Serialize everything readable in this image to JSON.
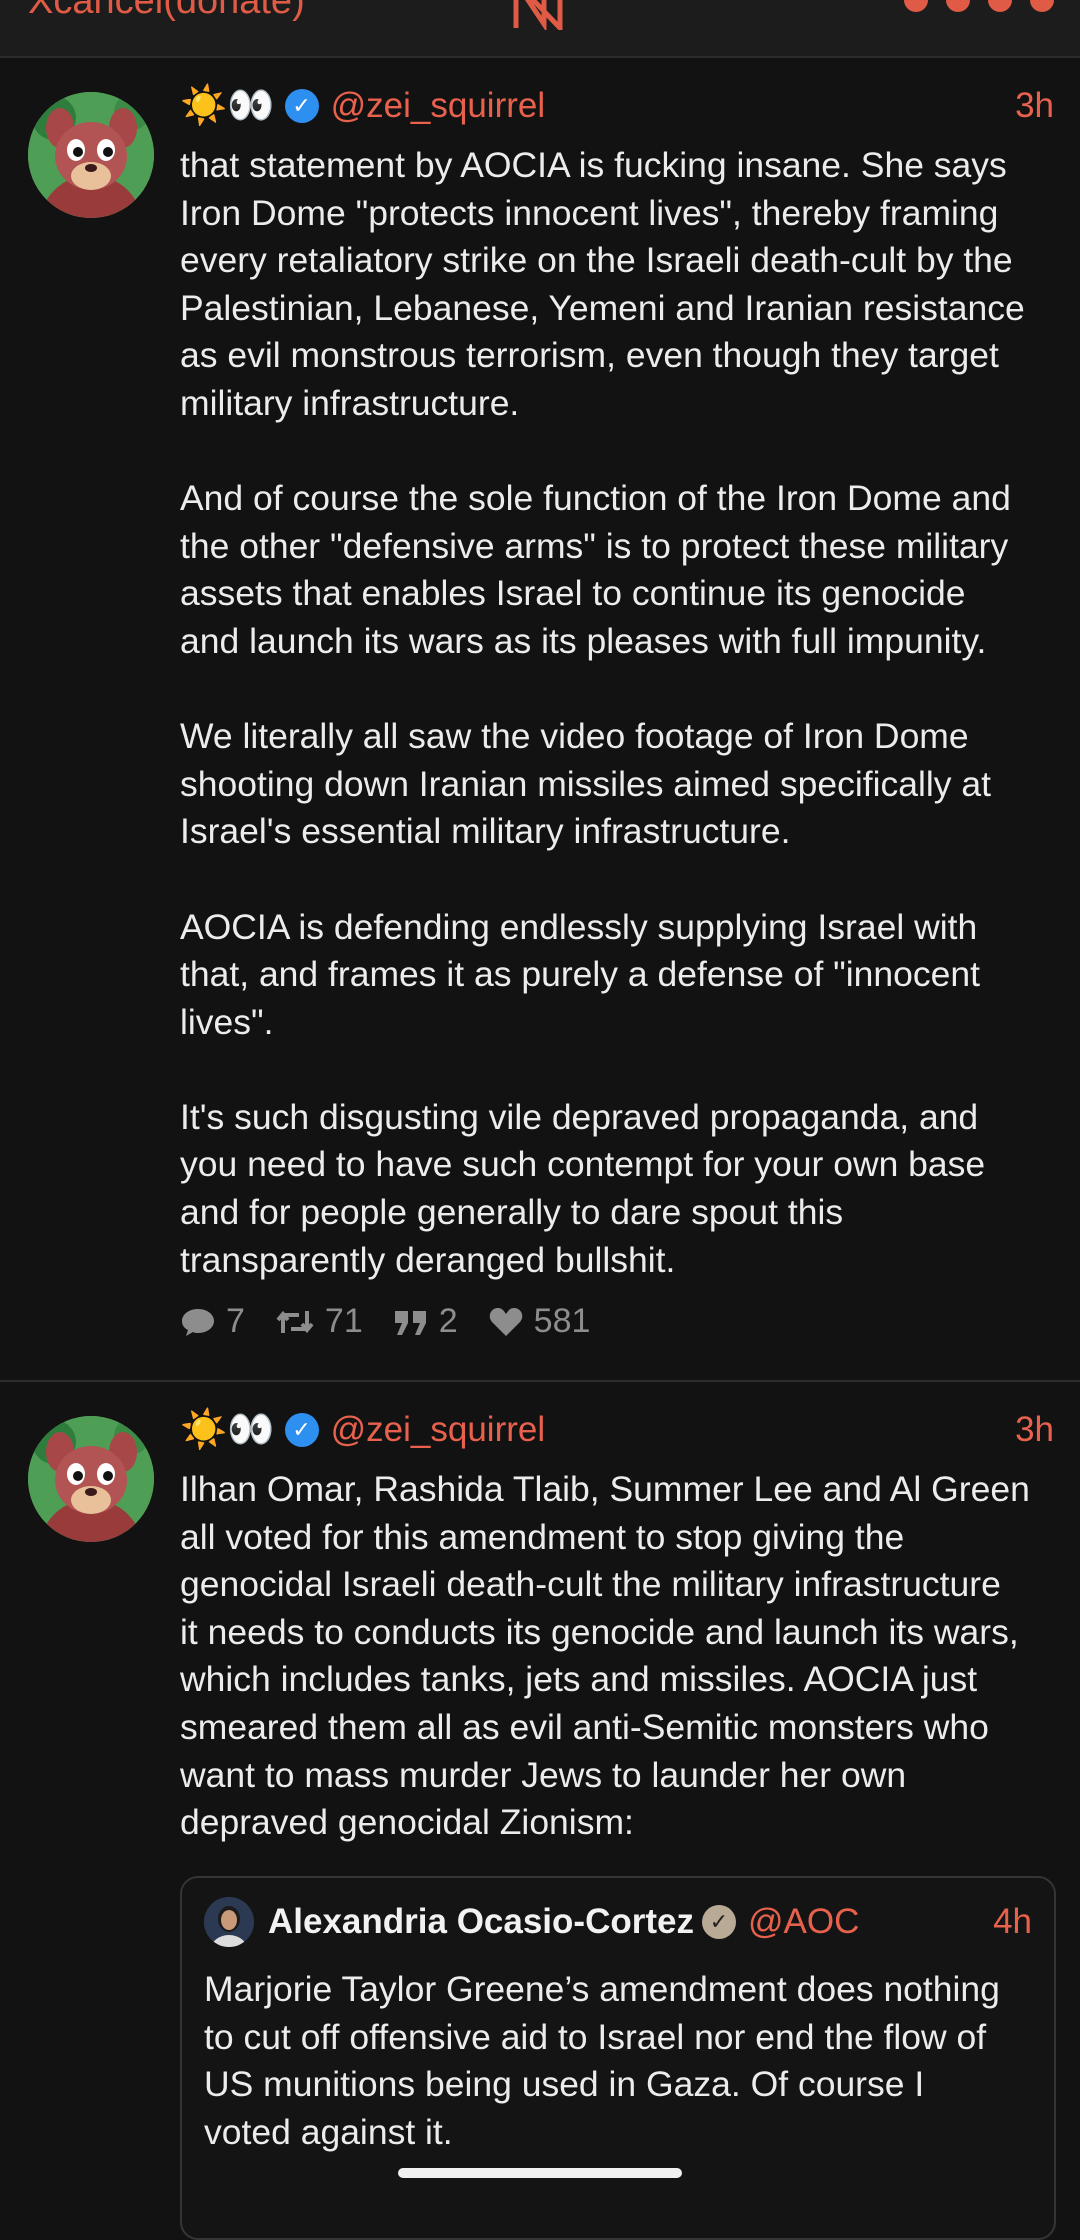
{
  "header": {
    "app_title": "Xcancel(donate)",
    "logo_letter": "N",
    "status_icons": [
      "wifi-icon",
      "signal-icon",
      "notification-icon",
      "battery-icon"
    ]
  },
  "posts": [
    {
      "emoji": "☀️👀",
      "handle": "@zei_squirrel",
      "time": "3h",
      "text": "that statement by AOCIA is fucking insane. She says\nIron Dome \"protects innocent lives\", thereby framing\nevery retaliatory strike on the Israeli death-cult by the\nPalestinian, Lebanese, Yemeni and Iranian resistance\nas evil monstrous terrorism, even though they target\nmilitary infrastructure.\n\nAnd of course the sole function of the Iron Dome and\nthe other \"defensive arms\" is to protect these military\nassets that enables Israel to continue its genocide\nand launch its wars as its pleases with full impunity.\n\nWe literally all saw the video footage of Iron Dome\nshooting down Iranian missiles aimed specifically at\nIsrael's essential military infrastructure.\n\nAOCIA is defending endlessly supplying Israel with\nthat, and frames it as purely a defense of \"innocent\nlives\".\n\nIt's such disgusting vile depraved propaganda, and\nyou need to have such contempt for your own base\nand for people generally to dare spout this\ntransparently deranged bullshit.",
      "stats": {
        "replies": "7",
        "retweets": "71",
        "quotes": "2",
        "likes": "581"
      }
    },
    {
      "emoji": "☀️👀",
      "handle": "@zei_squirrel",
      "time": "3h",
      "text": "Ilhan Omar, Rashida Tlaib, Summer Lee and Al Green\nall voted for this amendment to stop giving the\ngenocidal Israeli death-cult the military infrastructure\nit needs to conducts its genocide and launch its wars,\nwhich includes tanks, jets and missiles. AOCIA just\nsmeared them all as evil anti-Semitic monsters who\nwant to mass murder Jews to launder her own\ndepraved genocidal Zionism:",
      "quote": {
        "name": "Alexandria Ocasio-Cortez",
        "handle": "@AOC",
        "time": "4h",
        "text": "Marjorie Taylor Greene’s amendment does nothing\nto cut off offensive aid to Israel nor end the flow of\nUS munitions being used in Gaza. Of course I\nvoted against it."
      }
    }
  ],
  "colors": {
    "background": "#121212",
    "accent": "#e8614d",
    "verified_blue": "#2d8ff0",
    "muted": "#8d8d8d"
  }
}
